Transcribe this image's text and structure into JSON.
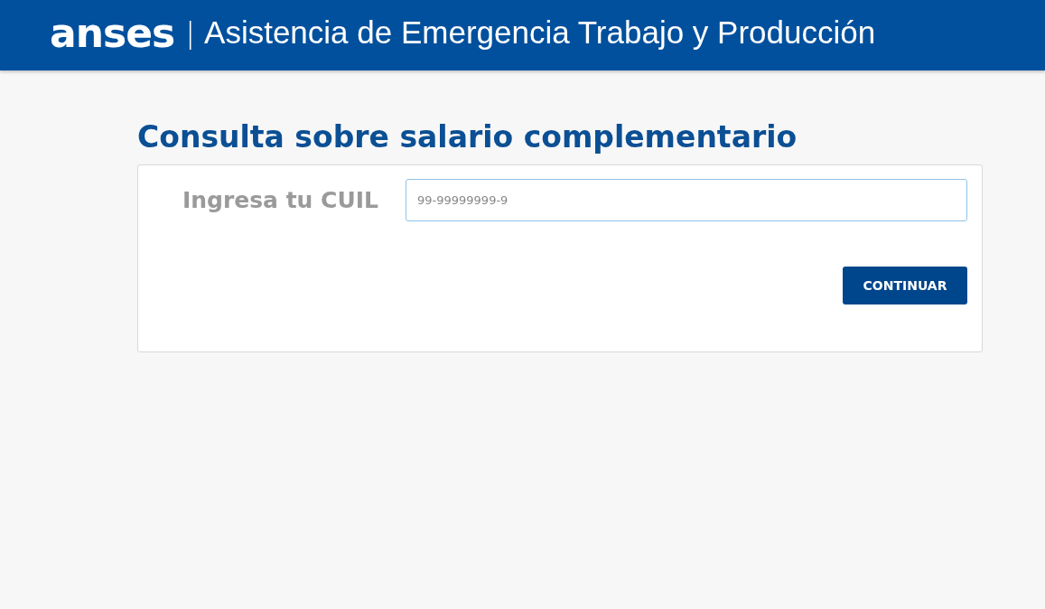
{
  "header": {
    "logo": "anses",
    "separator": "|",
    "title": "Asistencia de Emergencia Trabajo y Producción"
  },
  "page_title": "Consulta sobre salario complementario",
  "form": {
    "label": "Ingresa tu CUIL",
    "cuil_field": {
      "placeholder": "99-99999999-9"
    },
    "button": "CONTINUAR"
  }
}
